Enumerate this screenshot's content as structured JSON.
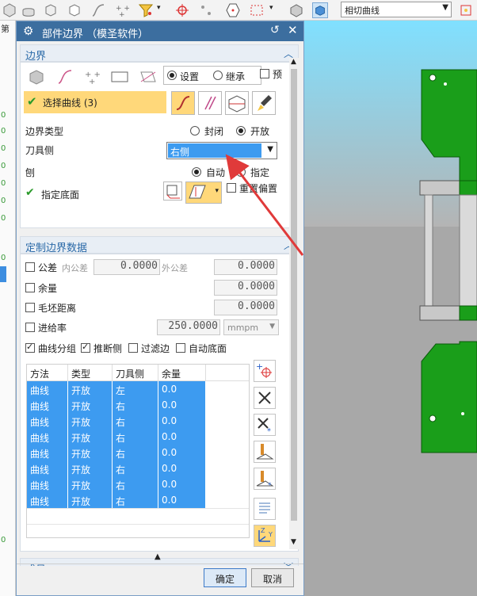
{
  "toolbar": {
    "filter_value": "相切曲线",
    "icons": [
      "cube-icon",
      "cylinder-icon",
      "box-icon",
      "spline-icon",
      "points-icon",
      "filter-icon",
      "snap-icon",
      "hex-icon",
      "rect-select-icon",
      "solid-icon",
      "view-cube-icon"
    ]
  },
  "left_strip": {
    "numbers": [
      "0",
      "0",
      "0",
      "0",
      "0",
      "0",
      "0",
      "0",
      "0"
    ],
    "text": "第"
  },
  "dialog": {
    "title": "部件边界 （模圣软件）",
    "boundary_section": {
      "header": "边界",
      "settings_label": "设置",
      "inherit_label": "继承",
      "preview_label": "预",
      "select_curve_label": "选择曲线 (3)",
      "boundary_type_label": "边界类型",
      "closed_label": "封闭",
      "open_label": "开放",
      "tool_side_label": "刀具侧",
      "tool_side_value": "右侧",
      "plane_label": "刨",
      "auto_label": "自动",
      "specify_label": "指定",
      "specify_floor_label": "指定底面",
      "reset_offset_label": "重置偏置"
    },
    "custom_section": {
      "header": "定制边界数据",
      "tolerance_label": "公差",
      "inner_tol_label": "内公差",
      "inner_tol_value": "0.0000",
      "outer_tol_label": "外公差",
      "outer_tol_value": "0.0000",
      "stock_label": "余量",
      "stock_value": "0.0000",
      "blank_dist_label": "毛坯距离",
      "blank_dist_value": "0.0000",
      "feed_label": "进给率",
      "feed_value": "250.0000",
      "feed_unit": "mmpm",
      "curve_group_label": "曲线分组",
      "infer_side_label": "推断侧",
      "filter_edge_label": "过滤边",
      "auto_floor_label": "自动底面"
    },
    "table": {
      "headers": [
        "方法",
        "类型",
        "刀具侧",
        "余量"
      ],
      "rows": [
        [
          "曲线",
          "开放",
          "左",
          "0.0"
        ],
        [
          "曲线",
          "开放",
          "右",
          "0.0"
        ],
        [
          "曲线",
          "开放",
          "右",
          "0.0"
        ],
        [
          "曲线",
          "开放",
          "右",
          "0.0"
        ],
        [
          "曲线",
          "开放",
          "右",
          "0.0"
        ],
        [
          "曲线",
          "开放",
          "右",
          "0.0"
        ],
        [
          "曲线",
          "开放",
          "右",
          "0.0"
        ],
        [
          "曲线",
          "开放",
          "右",
          "0.0"
        ]
      ]
    },
    "members_section": {
      "header": "成员"
    },
    "ok_label": "确定",
    "cancel_label": "取消"
  },
  "colors": {
    "title_bar": "#3c6e9f",
    "selection_highlight": "#ffd87a",
    "table_row": "#3d9bf0",
    "model_green": "#1a9e1a",
    "arrow_red": "#e03a3a"
  }
}
